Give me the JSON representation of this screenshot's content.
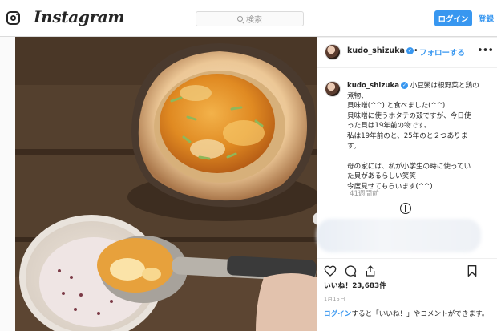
{
  "nav": {
    "logo_icon": "instagram-glyph-icon",
    "wordmark": "Instagram",
    "search_placeholder": "検索",
    "search_icon": "search-icon",
    "login_label": "ログイン",
    "signup_label": "登録",
    "accent_color": "#3897f0"
  },
  "post": {
    "username": "kudo_shizuka",
    "verified": true,
    "separator": "•",
    "follow_label": "フォローする",
    "more_icon": "more-options-icon",
    "caption_lines": [
      "小豆粥は根野菜と鶏の",
      "煮物、",
      "貝味噌(^^) と食べました(^^)",
      "貝味噌に使うホタテの殻ですが、今日使",
      "った貝は19年前の物です。",
      "私は19年前のと、25年のと２つありま",
      "す。",
      "",
      "母の家には、私が小学生の時に使ってい",
      "た貝があるらしい笑笑",
      "今度見せてもらいます(^^)"
    ],
    "time_ago": "41週間前",
    "load_more_icon": "load-more-comments-icon",
    "likes_label": "いいね！23,683件",
    "date": "1月15日",
    "login_prompt": {
      "link": "ログイン",
      "text": "すると「いいね！」やコメントができます。"
    },
    "carousel_icon": "chevron-right-icon",
    "image_alt": "ホタテの殻で焼いた貝味噌と小豆粥"
  }
}
